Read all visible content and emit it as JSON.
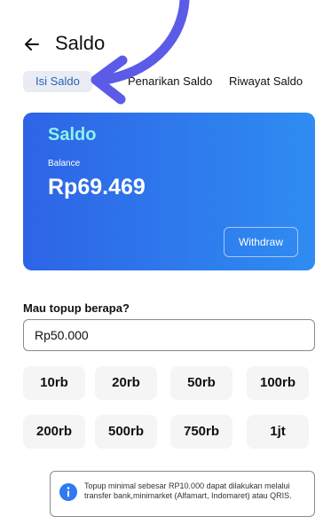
{
  "header": {
    "title": "Saldo"
  },
  "tabs": [
    {
      "label": "Isi Saldo"
    },
    {
      "label": "Penarikan Saldo"
    },
    {
      "label": "Riwayat Saldo"
    }
  ],
  "balance_card": {
    "title": "Saldo",
    "subtitle": "Balance",
    "amount": "Rp69.469",
    "withdraw_label": "Withdraw"
  },
  "topup": {
    "question": "Mau topup berapa?",
    "input_value": "Rp50.000",
    "options": [
      "10rb",
      "20rb",
      "50rb",
      "100rb",
      "200rb",
      "500rb",
      "750rb",
      "1jt"
    ]
  },
  "info": {
    "text": "Topup minimal sebesar RP10.000 dapat dilakukan melalui transfer bank,minimarket (Alfamart, Indomaret) atau QRIS."
  },
  "colors": {
    "accent": "#2f7af0",
    "card_title": "#8ef2ec",
    "pointer_arrow": "#5b5be8"
  },
  "icons": {
    "back": "arrow-left-icon",
    "info": "info-circle-icon",
    "pointer": "curved-arrow-pointer"
  }
}
